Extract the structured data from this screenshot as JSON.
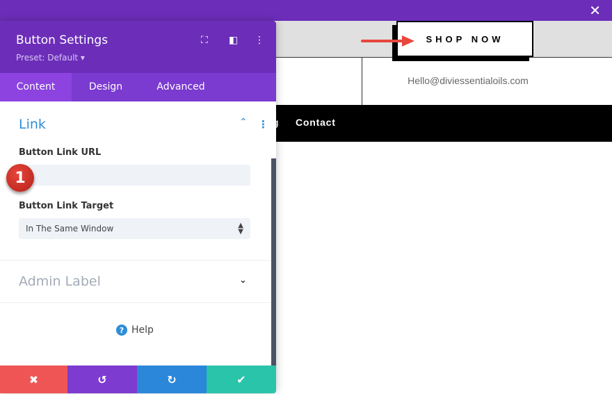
{
  "page": {
    "close_icon": "✕",
    "shop_button": "SHOP NOW",
    "email": "Hello@diviessentialoils.com",
    "nav_partial": "g",
    "nav_contact": "Contact"
  },
  "panel": {
    "title": "Button Settings",
    "preset": "Preset: Default ▾",
    "tabs": [
      {
        "label": "Content"
      },
      {
        "label": "Design"
      },
      {
        "label": "Advanced"
      }
    ],
    "link_section": {
      "title": "Link",
      "url_label": "Button Link URL",
      "url_value": "",
      "target_label": "Button Link Target",
      "target_value": "In The Same Window"
    },
    "admin_label": "Admin Label",
    "help": "Help",
    "step_badge": "1",
    "colors": {
      "header": "#6c2eb9",
      "accent": "#2e8dd8",
      "cancel": "#ef5555",
      "undo": "#7e3bd0",
      "redo": "#2b87da",
      "save": "#29c4a9"
    }
  }
}
